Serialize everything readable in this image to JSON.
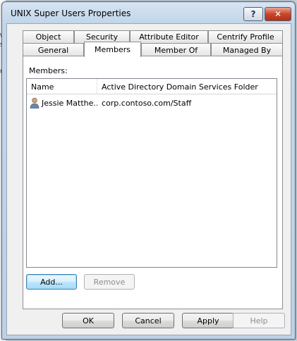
{
  "background": {
    "chars": [
      "\\",
      "s",
      "u"
    ]
  },
  "window": {
    "title": "UNIX Super Users Properties",
    "help_label": "?",
    "close_label": "✕"
  },
  "tabs_row1": [
    {
      "label": "Object"
    },
    {
      "label": "Security"
    },
    {
      "label": "Attribute Editor"
    },
    {
      "label": "Centrify Profile"
    }
  ],
  "tabs_row2": [
    {
      "label": "General"
    },
    {
      "label": "Members",
      "active": true
    },
    {
      "label": "Member Of"
    },
    {
      "label": "Managed By"
    }
  ],
  "members_panel": {
    "label": "Members:",
    "columns": [
      "Name",
      "Active Directory Domain Services Folder"
    ],
    "rows": [
      {
        "name": "Jessie Matthe...",
        "folder": "corp.contoso.com/Staff",
        "icon": "user-icon"
      }
    ],
    "add_label": "Add...",
    "remove_label": "Remove"
  },
  "footer": {
    "ok_label": "OK",
    "cancel_label": "Cancel",
    "apply_label": "Apply",
    "help_label": "Help"
  },
  "colors": {
    "title_bar": "#c2d5ea",
    "close_button": "#c9452a",
    "default_button": "#3c7fb1"
  }
}
